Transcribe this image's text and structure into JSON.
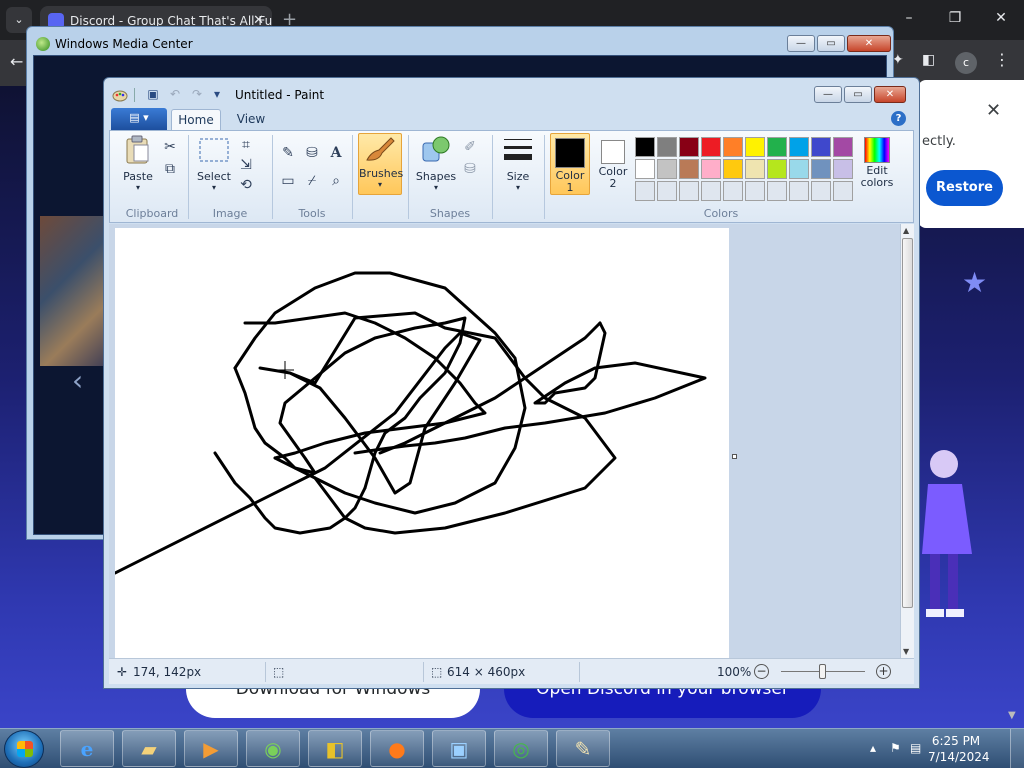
{
  "browser": {
    "tab_title": "Discord - Group Chat That's All Fun & Game",
    "tab_close": "✕",
    "new_tab": "+",
    "back": "←",
    "profile_initial": "c",
    "restore_text": "ectly.",
    "restore_button": "Restore",
    "restore_close": "✕",
    "download_button": "Download for Windows",
    "open_browser_button": "Open Discord in your browser"
  },
  "wmc": {
    "title": "Windows Media Center"
  },
  "paint": {
    "title": "Untitled - Paint",
    "tabs": {
      "home": "Home",
      "view": "View"
    },
    "help": "?",
    "groups": {
      "clipboard": "Clipboard",
      "image": "Image",
      "tools": "Tools",
      "shapes": "Shapes",
      "colors": "Colors"
    },
    "buttons": {
      "paste": "Paste",
      "select": "Select",
      "brushes": "Brushes",
      "shapes": "Shapes",
      "size": "Size",
      "color1": "Color 1",
      "color2": "Color 2",
      "edit_colors": "Edit colors"
    },
    "color1": "#000000",
    "color2": "#ffffff",
    "palette_row1": [
      "#000000",
      "#7f7f7f",
      "#880015",
      "#ed1c24",
      "#ff7f27",
      "#fff200",
      "#22b14c",
      "#00a2e8",
      "#3f48cc",
      "#a349a4"
    ],
    "palette_row2": [
      "#ffffff",
      "#c3c3c3",
      "#b97a57",
      "#ffaec9",
      "#ffc90e",
      "#efe4b0",
      "#b5e61d",
      "#99d9ea",
      "#7092be",
      "#c8bfe7"
    ],
    "palette_row3": [
      "#dfe6ef",
      "#dfe6ef",
      "#dfe6ef",
      "#dfe6ef",
      "#dfe6ef",
      "#dfe6ef",
      "#dfe6ef",
      "#dfe6ef",
      "#dfe6ef",
      "#dfe6ef"
    ],
    "status": {
      "cursor_pos": "174, 142px",
      "canvas_size": "614 × 460px",
      "zoom": "100%",
      "zoom_fraction": 0.5
    }
  },
  "taskbar": {
    "time": "6:25 PM",
    "date": "7/14/2024"
  }
}
